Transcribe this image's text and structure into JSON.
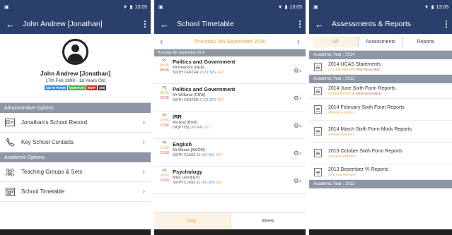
{
  "status": {
    "time": "13:05"
  },
  "panel1": {
    "title": "John Andrew [Jonathan]",
    "name": "John Andrew [Jonathan]",
    "dob": "17th Feb 1998 - 18 Years Old",
    "badges": [
      {
        "label": "SIXTH FORM",
        "color": "#3a8fd6"
      },
      {
        "label": "MONITOR",
        "color": "#4caf50"
      },
      {
        "label": "IMAP",
        "color": "#d32f2f"
      },
      {
        "label": "SMI",
        "color": "#444444"
      }
    ],
    "section_admin": "Administrative Options",
    "admin_items": [
      {
        "label": "Jonathan's School Record",
        "icon": "id-card-icon"
      },
      {
        "label": "Key School Contacts",
        "icon": "phone-icon"
      }
    ],
    "section_academic": "Academic Options",
    "academic_items": [
      {
        "label": "Teaching Groups & Sets",
        "icon": "group-icon"
      },
      {
        "label": "School Timetable",
        "icon": "calendar-icon"
      }
    ]
  },
  "panel2": {
    "title": "School Timetable",
    "date": "Thursday 8th September 2016",
    "day_header": "Thursday 8th September 2016",
    "lessons": [
      {
        "period": "P1",
        "start": "09:35",
        "end": "09:35",
        "subject": "Politics and Government",
        "teacher": "Mr Peacock [PEA]",
        "room": "SIXTH CENTER 2",
        "group": "UVI.3PG",
        "set": "SET"
      },
      {
        "period": "P2",
        "start": "09:35",
        "end": "10:35",
        "subject": "Politics and Government",
        "teacher": "Mr Williams [CNW]",
        "room": "SIXTH CENTER 2",
        "group": "UVI.3PG",
        "set": "SET"
      },
      {
        "period": "P3",
        "start": "10:55",
        "end": "11:50",
        "subject": "IRR",
        "teacher": "Ms Ray [BUR]",
        "room": "D4 [PY55]",
        "group": "UVI.IRR",
        "set": "SET"
      },
      {
        "period": "P4",
        "start": "11:50",
        "end": "12:50",
        "subject": "English",
        "teacher": "Mr Moses [AMOO]",
        "room": "SIXTH CLASS 11",
        "group": "UVI.1CL",
        "set": "SET"
      },
      {
        "period": "P6",
        "start": "14:50",
        "end": "15:50",
        "subject": "Psychology",
        "teacher": "Miss Levi [LEV]",
        "room": "SIXTH CLASS 11",
        "group": "UVI.2PS",
        "set": "SET"
      }
    ],
    "tab_day": "Day",
    "tab_week": "Week"
  },
  "panel3": {
    "title": "Assessments & Reports",
    "tabs": [
      "All",
      "Assessments",
      "Reports"
    ],
    "years": [
      {
        "label": "Academic Year : 2014",
        "items": [
          {
            "title": "2014 UCAS Statements",
            "term": "AUTUMN",
            "type": "REPORT",
            "pdf": "PDF AVAILABLE"
          }
        ]
      },
      {
        "label": "Academic Year : 2013",
        "items": [
          {
            "title": "2014 June Sixth Form Reports",
            "term": "SUMMER",
            "type": "REPORT",
            "pdf": "PDF AVAILABLE"
          },
          {
            "title": "2014 February Sixth Form Reports",
            "term": "SPRING",
            "type": "REPORT",
            "pdf": ""
          },
          {
            "title": "2014 March Sixth Form Mock Reports",
            "term": "SPRING",
            "type": "REPORT",
            "pdf": ""
          },
          {
            "title": "2013 October Sixth Form Reports",
            "term": "AUTUMN",
            "type": "REPORT",
            "pdf": ""
          },
          {
            "title": "2013 December VI Reports",
            "term": "AUTUMN",
            "type": "REPORT",
            "pdf": ""
          }
        ]
      },
      {
        "label": "Academic Year : 2012",
        "items": []
      }
    ]
  }
}
